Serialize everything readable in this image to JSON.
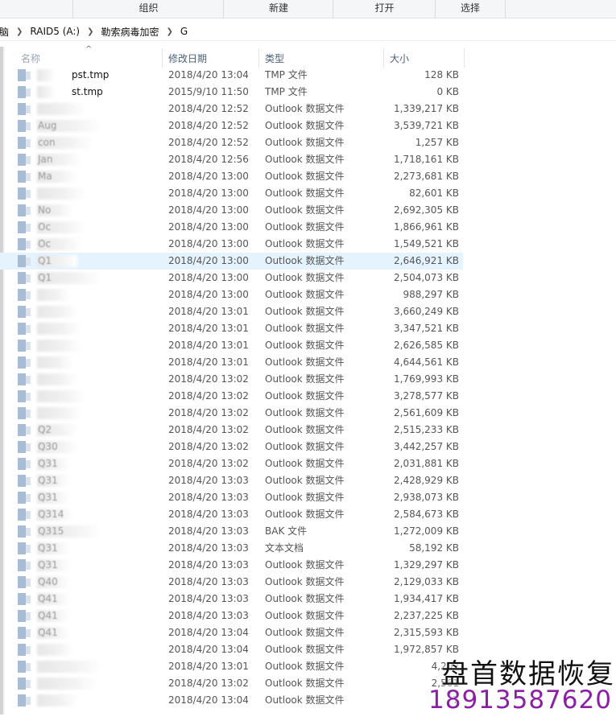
{
  "ribbon": {
    "groups": [
      "组织",
      "新建",
      "打开",
      "选择"
    ]
  },
  "breadcrumb": {
    "items": [
      "脑",
      "RAID5 (A:)",
      "勒索病毒加密",
      "G"
    ]
  },
  "columns": {
    "name": "名称",
    "date": "修改日期",
    "type": "类型",
    "size": "大小"
  },
  "files": [
    {
      "name": "pst.tmp",
      "date": "2018/4/20 13:04",
      "type": "TMP 文件",
      "size": "128 KB"
    },
    {
      "name": "st.tmp",
      "date": "2015/9/10 11:50",
      "type": "TMP 文件",
      "size": "0 KB"
    },
    {
      "name": "",
      "date": "2018/4/20 12:52",
      "type": "Outlook 数据文件",
      "size": "1,339,217 KB"
    },
    {
      "name": "Aug",
      "date": "2018/4/20 12:52",
      "type": "Outlook 数据文件",
      "size": "3,539,721 KB"
    },
    {
      "name": "con",
      "date": "2018/4/20 12:52",
      "type": "Outlook 数据文件",
      "size": "1,257 KB"
    },
    {
      "name": "Jan",
      "date": "2018/4/20 12:56",
      "type": "Outlook 数据文件",
      "size": "1,718,161 KB"
    },
    {
      "name": "Ma",
      "date": "2018/4/20 13:00",
      "type": "Outlook 数据文件",
      "size": "2,273,681 KB"
    },
    {
      "name": "",
      "date": "2018/4/20 13:00",
      "type": "Outlook 数据文件",
      "size": "82,601 KB"
    },
    {
      "name": "No",
      "date": "2018/4/20 13:00",
      "type": "Outlook 数据文件",
      "size": "2,692,305 KB"
    },
    {
      "name": "Oc",
      "date": "2018/4/20 13:00",
      "type": "Outlook 数据文件",
      "size": "1,866,961 KB"
    },
    {
      "name": "Oc",
      "date": "2018/4/20 13:00",
      "type": "Outlook 数据文件",
      "size": "1,549,521 KB"
    },
    {
      "name": "Q1",
      "date": "2018/4/20 13:00",
      "type": "Outlook 数据文件",
      "size": "2,646,921 KB"
    },
    {
      "name": "Q1",
      "date": "2018/4/20 13:00",
      "type": "Outlook 数据文件",
      "size": "2,504,073 KB"
    },
    {
      "name": "",
      "date": "2018/4/20 13:00",
      "type": "Outlook 数据文件",
      "size": "988,297 KB"
    },
    {
      "name": "",
      "date": "2018/4/20 13:01",
      "type": "Outlook 数据文件",
      "size": "3,660,249 KB"
    },
    {
      "name": "",
      "date": "2018/4/20 13:01",
      "type": "Outlook 数据文件",
      "size": "3,347,521 KB"
    },
    {
      "name": "",
      "date": "2018/4/20 13:01",
      "type": "Outlook 数据文件",
      "size": "2,626,585 KB"
    },
    {
      "name": "",
      "date": "2018/4/20 13:01",
      "type": "Outlook 数据文件",
      "size": "4,644,561 KB"
    },
    {
      "name": "",
      "date": "2018/4/20 13:02",
      "type": "Outlook 数据文件",
      "size": "1,769,993 KB"
    },
    {
      "name": "",
      "date": "2018/4/20 13:02",
      "type": "Outlook 数据文件",
      "size": "3,278,577 KB"
    },
    {
      "name": "",
      "date": "2018/4/20 13:02",
      "type": "Outlook 数据文件",
      "size": "2,561,609 KB"
    },
    {
      "name": "Q2",
      "date": "2018/4/20 13:02",
      "type": "Outlook 数据文件",
      "size": "2,515,233 KB"
    },
    {
      "name": "Q30",
      "date": "2018/4/20 13:02",
      "type": "Outlook 数据文件",
      "size": "3,442,257 KB"
    },
    {
      "name": "Q31",
      "date": "2018/4/20 13:02",
      "type": "Outlook 数据文件",
      "size": "2,031,881 KB"
    },
    {
      "name": "Q31",
      "date": "2018/4/20 13:03",
      "type": "Outlook 数据文件",
      "size": "2,428,929 KB"
    },
    {
      "name": "Q31",
      "date": "2018/4/20 13:03",
      "type": "Outlook 数据文件",
      "size": "2,938,073 KB"
    },
    {
      "name": "Q314",
      "date": "2018/4/20 13:03",
      "type": "Outlook 数据文件",
      "size": "2,584,673 KB"
    },
    {
      "name": "Q315",
      "date": "2018/4/20 13:03",
      "type": "BAK 文件",
      "size": "1,272,009 KB"
    },
    {
      "name": "Q31",
      "date": "2018/4/20 13:03",
      "type": "文本文档",
      "size": "58,192 KB"
    },
    {
      "name": "Q31",
      "date": "2018/4/20 13:03",
      "type": "Outlook 数据文件",
      "size": "1,329,297 KB"
    },
    {
      "name": "Q40",
      "date": "2018/4/20 13:03",
      "type": "Outlook 数据文件",
      "size": "2,129,033 KB"
    },
    {
      "name": "Q41",
      "date": "2018/4/20 13:03",
      "type": "Outlook 数据文件",
      "size": "1,934,417 KB"
    },
    {
      "name": "Q41",
      "date": "2018/4/20 13:03",
      "type": "Outlook 数据文件",
      "size": "2,237,225 KB"
    },
    {
      "name": "Q41",
      "date": "2018/4/20 13:04",
      "type": "Outlook 数据文件",
      "size": "2,315,593 KB"
    },
    {
      "name": "",
      "date": "2018/4/20 13:04",
      "type": "Outlook 数据文件",
      "size": "1,972,857 KB"
    },
    {
      "name": "",
      "date": "2018/4/20 13:01",
      "type": "Outlook 数据文件",
      "size": "4,202"
    },
    {
      "name": "",
      "date": "2018/4/20 13:02",
      "type": "Outlook 数据文件",
      "size": "2,561"
    },
    {
      "name": "",
      "date": "2018/4/20 13:04",
      "type": "Outlook 数据文件",
      "size": "7"
    }
  ],
  "selected_row_index": 11,
  "watermark": {
    "brand": "盘首数据恢复",
    "phone": "18913587620"
  },
  "colors": {
    "selection": "#e5f3ff",
    "header_text": "#4c607a",
    "watermark_phone": "#8b1fa6"
  }
}
